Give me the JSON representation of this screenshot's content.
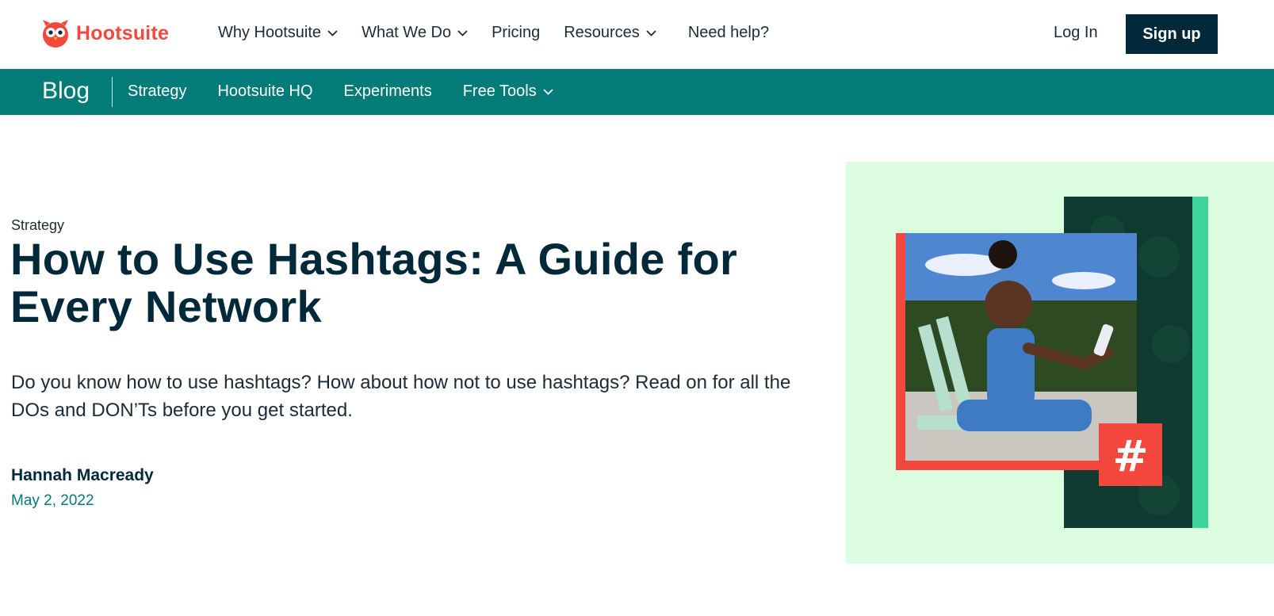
{
  "brand": {
    "name": "Hootsuite",
    "accent": "#f4483f",
    "dark": "#012939",
    "teal": "#037b78"
  },
  "topnav": {
    "items": [
      {
        "label": "Why Hootsuite",
        "has_dropdown": true
      },
      {
        "label": "What We Do",
        "has_dropdown": true
      },
      {
        "label": "Pricing",
        "has_dropdown": false
      },
      {
        "label": "Resources",
        "has_dropdown": true
      },
      {
        "label": "Need help?",
        "has_dropdown": false
      }
    ],
    "login_label": "Log In",
    "signup_label": "Sign up"
  },
  "blognav": {
    "title": "Blog",
    "items": [
      {
        "label": "Strategy",
        "has_dropdown": false
      },
      {
        "label": "Hootsuite HQ",
        "has_dropdown": false
      },
      {
        "label": "Experiments",
        "has_dropdown": false
      },
      {
        "label": "Free Tools",
        "has_dropdown": true
      }
    ]
  },
  "article": {
    "category": "Strategy",
    "title": "How to Use Hashtags: A Guide for Every Network",
    "dek": "Do you know how to use hashtags? How about how not to use hashtags? Read on for all the DOs and DON’Ts before you get started.",
    "author": "Hannah Macready",
    "date": "May 2, 2022"
  },
  "hero_image": {
    "badge_symbol": "#",
    "colors": {
      "panel_bg": "#dcfde0",
      "frame_red": "#f4483f",
      "dark_green": "#0e3a2f",
      "stripe_green": "#3fd59b"
    }
  }
}
